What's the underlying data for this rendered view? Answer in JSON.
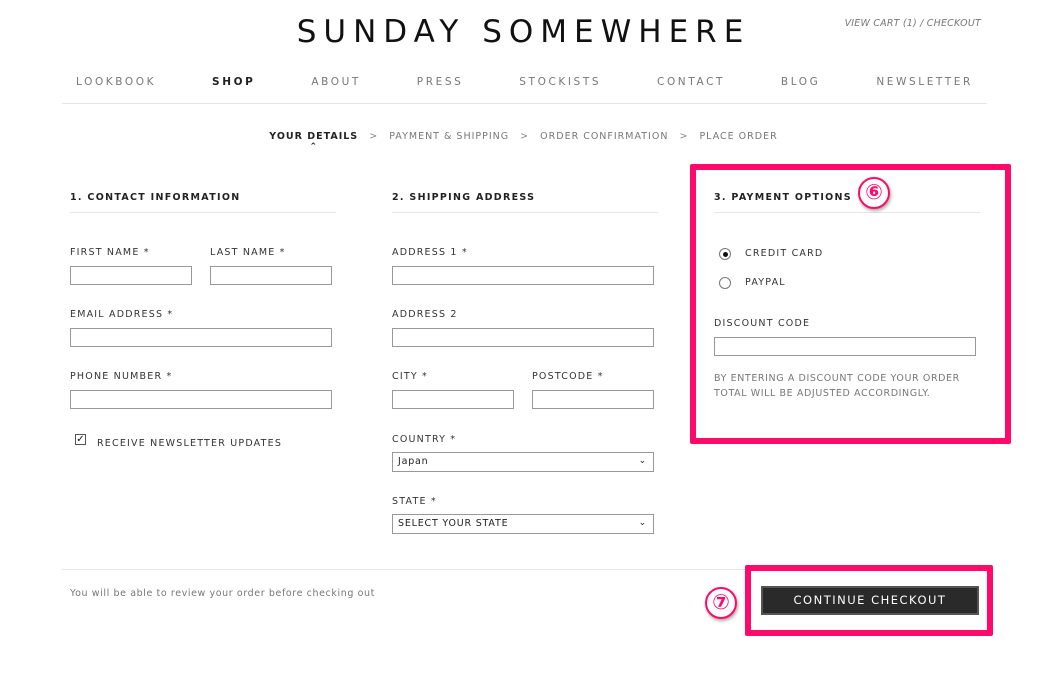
{
  "brand": "SUNDAY SOMEWHERE",
  "cart_link": "VIEW CART (1) / CHECKOUT",
  "nav": [
    "LOOKBOOK",
    "SHOP",
    "ABOUT",
    "PRESS",
    "STOCKISTS",
    "CONTACT",
    "BLOG",
    "NEWSLETTER"
  ],
  "nav_active": "SHOP",
  "steps": [
    "YOUR DETAILS",
    "PAYMENT & SHIPPING",
    "ORDER CONFIRMATION",
    "PLACE ORDER"
  ],
  "step_separator": ">",
  "contact": {
    "title": "1. CONTACT INFORMATION",
    "first_name_label": "FIRST NAME *",
    "last_name_label": "LAST NAME *",
    "email_label": "EMAIL ADDRESS *",
    "phone_label": "PHONE NUMBER *",
    "newsletter_label": "RECEIVE NEWSLETTER UPDATES",
    "newsletter_checked": true
  },
  "shipping": {
    "title": "2. SHIPPING ADDRESS",
    "address1_label": "ADDRESS 1 *",
    "address2_label": "ADDRESS 2",
    "city_label": "CITY *",
    "postcode_label": "POSTCODE *",
    "country_label": "COUNTRY *",
    "country_value": "Japan",
    "state_label": "STATE *",
    "state_value": "SELECT YOUR STATE"
  },
  "payment": {
    "title": "3. PAYMENT OPTIONS",
    "options": [
      "CREDIT CARD",
      "PAYPAL"
    ],
    "selected": "CREDIT CARD",
    "discount_label": "DISCOUNT CODE",
    "discount_note_line1": "BY ENTERING A DISCOUNT CODE YOUR ORDER",
    "discount_note_line2": "TOTAL WILL BE ADJUSTED ACCORDINGLY."
  },
  "footer_note": "You will be able to review your order before checking out",
  "continue_label": "CONTINUE CHECKOUT",
  "annotations": [
    "⑥",
    "⑦"
  ],
  "highlight_color": "#ff0a6b"
}
